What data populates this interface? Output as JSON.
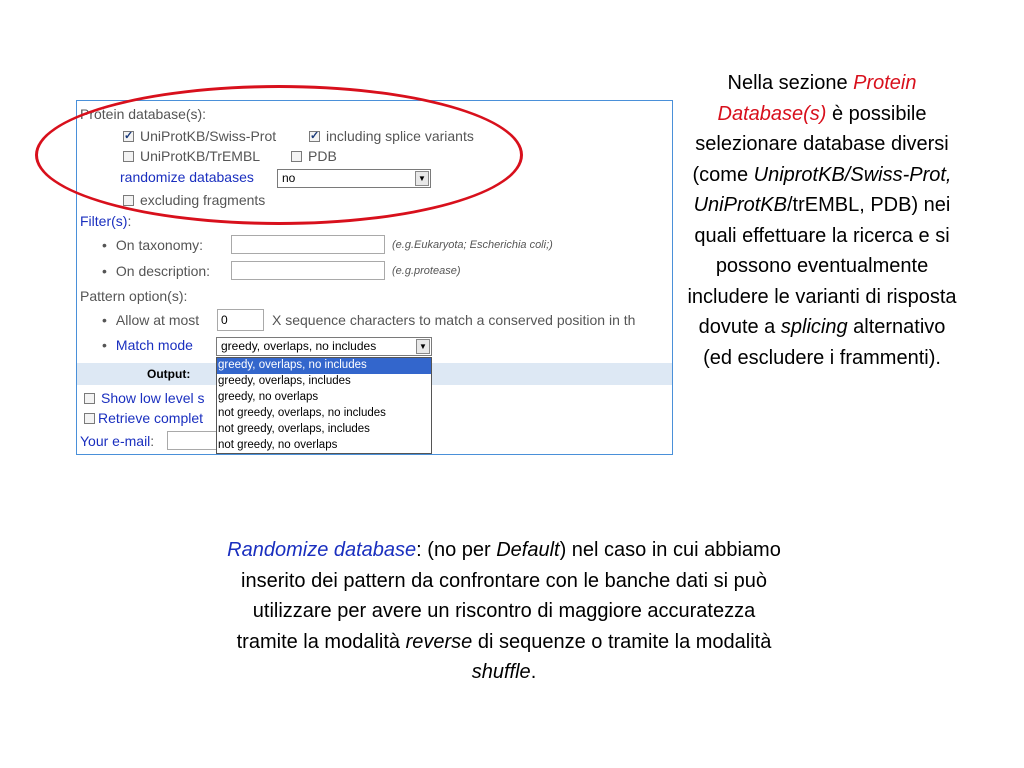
{
  "form": {
    "protein_db_label": "Protein database(s):",
    "swissprot": {
      "label": "UniProtKB/Swiss-Prot",
      "checked": true
    },
    "splice": {
      "label": "including splice variants",
      "checked": true
    },
    "trembl": {
      "label": "UniProtKB/TrEMBL",
      "checked": false
    },
    "pdb": {
      "label": "PDB",
      "checked": false
    },
    "randomize_label": "randomize databases",
    "randomize_value": "no",
    "excluding_label": "excluding fragments",
    "filters_label": "Filter(s)",
    "filters_colon": ":",
    "taxonomy_label": "On taxonomy:",
    "taxonomy_hint": "(e.g.Eukaryota; Escherichia coli;)",
    "description_label": "On description:",
    "description_hint": "(e.g.protease)",
    "pattern_label": "Pattern option(s):",
    "allow_label": "Allow at most",
    "allow_value": "0",
    "allow_suffix": "X sequence characters to match a conserved position in th",
    "match_label": "Match mode",
    "match_value": "greedy, overlaps, no includes",
    "match_options": [
      "greedy, overlaps, no includes",
      "greedy, overlaps, includes",
      "greedy, no overlaps",
      "not greedy, overlaps, no includes",
      "not greedy, overlaps, includes",
      "not greedy, no overlaps"
    ],
    "output_label": "Output:",
    "show_low_label": "Show low level s",
    "retrieve_label": "Retrieve complet",
    "email_label": "Your e-mail",
    "email_colon": ":"
  },
  "side_text": {
    "p1": "Nella sezione ",
    "p2": "Protein Database(s)",
    "p3": " è possibile selezionare database diversi (come ",
    "p4": "UniprotKB/Swiss-Prot, UniProtKB",
    "p5": "/trEMBL, PDB) nei quali effettuare la ricerca e si possono eventualmente includere le varianti  di risposta dovute a ",
    "p6": "splicing",
    "p7": " alternativo (ed escludere i frammenti)."
  },
  "bottom_text": {
    "p1": "Randomize database",
    "p2": ": (no per ",
    "p3": "Default",
    "p4": ") nel caso in cui abbiamo inserito dei pattern da confrontare con le banche dati si può utilizzare per avere un riscontro di maggiore accuratezza tramite la modalità ",
    "p5": "reverse",
    "p6": " di sequenze o tramite la modalità ",
    "p7": "shuffle",
    "p8": "."
  },
  "colors": {
    "annotation_ellipse": "#d8101c",
    "link_blue": "#1a2fbf",
    "panel_border": "#4a90d9",
    "selected_option": "#3366cc"
  },
  "icons": {
    "checkbox": "checkbox-icon",
    "dropdown_arrow": "chevron-down-icon"
  }
}
